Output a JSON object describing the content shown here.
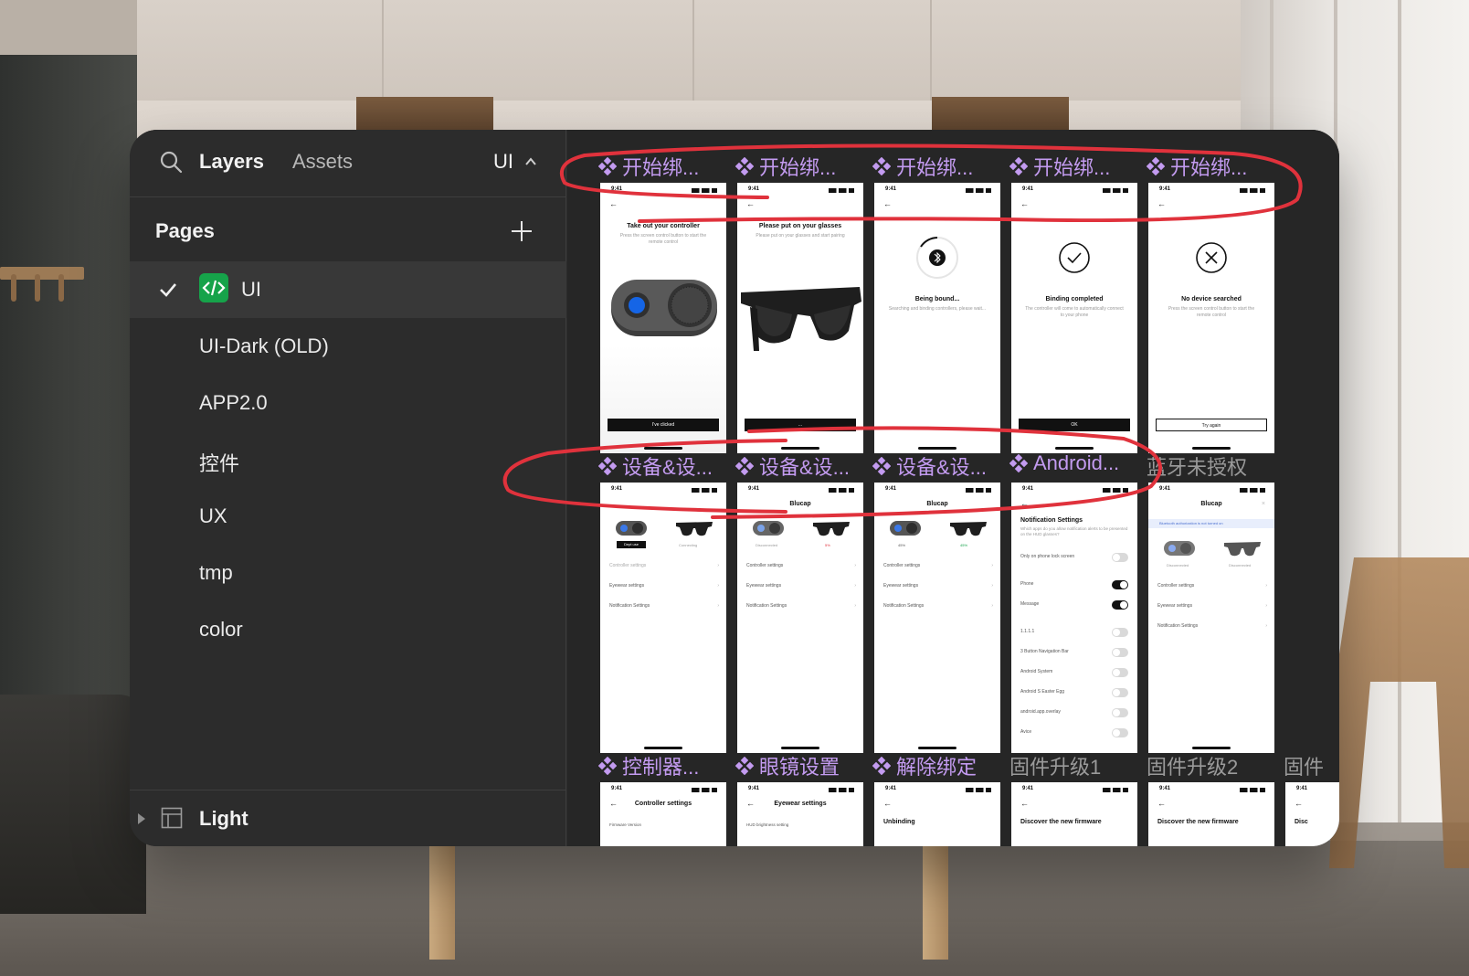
{
  "sidebar": {
    "tabs": {
      "layers": "Layers",
      "assets": "Assets"
    },
    "page_switch": "UI",
    "pages_title": "Pages",
    "pages": [
      {
        "label": "UI",
        "active": true
      },
      {
        "label": "UI-Dark (OLD)"
      },
      {
        "label": "APP2.0"
      },
      {
        "label": "控件"
      },
      {
        "label": "UX"
      },
      {
        "label": "tmp"
      },
      {
        "label": "color"
      }
    ],
    "bottom_layer": "Light"
  },
  "canvas": {
    "row1": {
      "labels": [
        "开始绑...",
        "开始绑...",
        "开始绑...",
        "开始绑...",
        "开始绑..."
      ],
      "screens": [
        {
          "time": "9:41",
          "title": "Take out your controller",
          "subtitle": "Press the screen control button to start the remote control",
          "button": "I've clicked"
        },
        {
          "time": "9:41",
          "title": "Please put on your glasses",
          "subtitle": "Please put on your glasses and start pairing",
          "button": "..."
        },
        {
          "time": "9:41",
          "title": "Being bound...",
          "subtitle": "Searching and binding controllers, please wait..."
        },
        {
          "time": "9:41",
          "title": "Binding completed",
          "subtitle": "The controller will come to automatically connect to your phone",
          "button": "OK"
        },
        {
          "time": "9:41",
          "title": "No device searched",
          "subtitle": "Press the screen control button to start the remote control",
          "button": "Try again"
        }
      ]
    },
    "row2": {
      "labels": [
        "设备&设...",
        "设备&设...",
        "设备&设...",
        "Android...",
        "蓝牙未授权"
      ],
      "device_title": "Blucap",
      "settings_rows": [
        "Controller settings",
        "Eyewear settings",
        "Notification Settings"
      ],
      "connect_label": "Dept use",
      "connecting_label": "Connecting",
      "disconnect_label": "Disconnected",
      "battery_low": "5%",
      "battery_mid": "45%",
      "battery_high": "45%",
      "bt_banner": "Bluetooth authorization is not turned on",
      "android": {
        "title": "Notification Settings",
        "subtitle": "Which apps do you allow notification alerts to be presented on the HUD glasses?",
        "rows": [
          {
            "label": "Only on phone lock screen",
            "on": false
          },
          {
            "label": "Phone",
            "on": true
          },
          {
            "label": "Message",
            "on": true
          },
          {
            "label": "1.1.1.1",
            "on": false
          },
          {
            "label": "3 Button Navigation Bar",
            "on": false
          },
          {
            "label": "Android System",
            "on": false
          },
          {
            "label": "Android S Easter Egg",
            "on": false
          },
          {
            "label": "android.app.overlay",
            "on": false
          },
          {
            "label": "Avice",
            "on": false
          }
        ]
      }
    },
    "row3": {
      "labels": [
        "控制器...",
        "眼镜设置",
        "解除绑定",
        "固件升级1",
        "固件升级2",
        "固件"
      ],
      "screens": [
        {
          "time": "9:41",
          "title": "Controller settings",
          "line": "Firmware Version"
        },
        {
          "time": "9:41",
          "title": "Eyewear settings",
          "line": "HUD brightness setting"
        },
        {
          "time": "9:41",
          "title": "Unbinding"
        },
        {
          "time": "9:41",
          "title": "Discover the new firmware"
        },
        {
          "time": "9:41",
          "title": "Discover the new firmware"
        },
        {
          "time": "9:41",
          "title": "Disc"
        }
      ]
    }
  },
  "colors": {
    "component_label": "#c39bf0",
    "annotation": "#e0323c",
    "code_badge": "#16a34a"
  }
}
